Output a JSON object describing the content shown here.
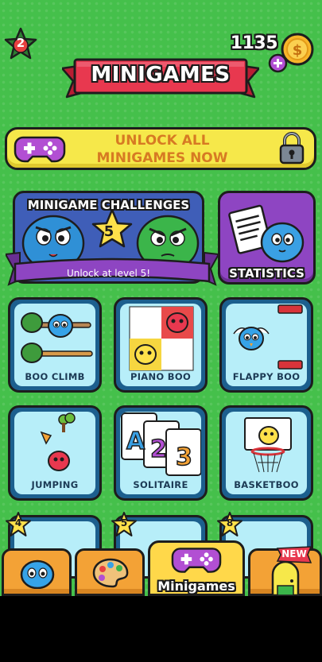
{
  "header": {
    "level": "2",
    "coins": "1135",
    "title": "MINIGAMES"
  },
  "unlock_banner": {
    "text": "UNLOCK ALL\nMINIGAMES NOW"
  },
  "challenges": {
    "title": "MINIGAME CHALLENGES",
    "star_number": "5",
    "subtitle": "Unlock at level 5!"
  },
  "statistics": {
    "label": "STATISTICS"
  },
  "games": [
    {
      "label": "BOO CLIMB"
    },
    {
      "label": "PIANO BOO"
    },
    {
      "label": "FLAPPY BOO"
    },
    {
      "label": "JUMPING"
    },
    {
      "label": "SOLITAIRE"
    },
    {
      "label": "BASKETBOO"
    }
  ],
  "solitaire_cards": [
    "A",
    "2",
    "3"
  ],
  "locked_games": [
    {
      "level": "4"
    },
    {
      "level": "5"
    },
    {
      "level": "8"
    }
  ],
  "nav": {
    "active_label": "Minigames",
    "new_badge": "NEW"
  },
  "colors": {
    "background": "#45c04b",
    "banner_red": "#e8384f",
    "unlock_yellow": "#f6e84a",
    "challenges_blue": "#3f5eb8",
    "stats_purple": "#8e45c2",
    "tile_frame": "#1c5f8e",
    "tile_fill": "#b7eef9",
    "nav_orange": "#f3a236"
  }
}
